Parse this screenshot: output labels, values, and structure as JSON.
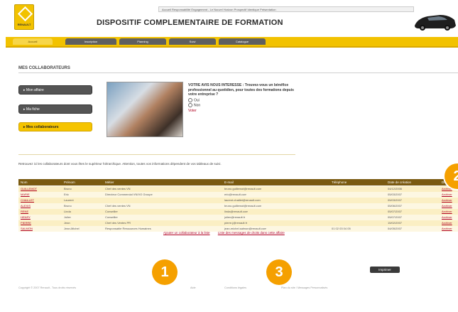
{
  "header": {
    "brand": "RENAULT",
    "topbar_text": "Accueil   Responsabilité Engagement - Le Nouvel Horizon   Prospectif Identique   Présentation",
    "title": "DISPOSITIF COMPLEMENTAIRE DE FORMATION",
    "tabs": [
      {
        "label": "Accueil",
        "active": true
      },
      {
        "label": "Inscription",
        "active": false
      },
      {
        "label": "Planning",
        "active": false
      },
      {
        "label": "Suivi",
        "active": false
      },
      {
        "label": "Catalogue",
        "active": false
      }
    ]
  },
  "section_title": "MES COLLABORATEURS",
  "sidebar": [
    {
      "label": "▸ Mon affaire",
      "style": "gray"
    },
    {
      "label": "▸ Ma fiche",
      "style": "gray"
    },
    {
      "label": "▸ Mes collaborateurs",
      "style": "yellow"
    }
  ],
  "poll": {
    "question": "VOTRE AVIS NOUS INTERESSE : Trouvez-vous un bénéfice professionnel au quotidien, pour toutes des formations depuis votre entreprise ?",
    "options": [
      "Oui",
      "Non"
    ],
    "vote": "Voter"
  },
  "info_text": "Retrouvez ici les collaborateurs dont vous êtes le supérieur hiérarchique. Attention, toutes vos informations dépendent de vos tableaux de suivi.",
  "table": {
    "headers": [
      "Nom",
      "Prénom",
      "Métier",
      "E-mail",
      "Téléphone",
      "Date de création",
      "Droits"
    ],
    "rows": [
      [
        "GUILLEMOT",
        "Bruno",
        "Chef des ventes VN",
        "bruno.guillemot@renault.com",
        "",
        "04/12/2006",
        "Archiver"
      ],
      [
        "MARIE",
        "Eric",
        "Directeur Commercial VN/VO Groupe",
        "eric@renault.com",
        "",
        "05/03/2007",
        "Archiver"
      ],
      [
        "CHAILLET",
        "Laurent",
        "",
        "laurent.chaillet@renault.com",
        "",
        "05/03/2007",
        "Archiver"
      ],
      [
        "ALEXIS",
        "Bruno",
        "Chef des ventes VN",
        "bruno.guillemot@renault.com",
        "",
        "05/06/2007",
        "Archiver"
      ],
      [
        "RENE",
        "Linda",
        "Conseiller",
        "linda@renault.com",
        "",
        "05/07/2007",
        "Archiver"
      ],
      [
        "HENRY",
        "Julien",
        "Conseiller",
        "julien@renault.fr",
        "",
        "05/07/2007",
        "Archiver"
      ],
      [
        "PIERRE",
        "Jean",
        "Chef des Ventes PR",
        "pierre.j@renault.fr",
        "",
        "15/02/2007",
        "Archiver"
      ],
      [
        "SALMON",
        "Jean-Michel",
        "Responsable Ressources Humaines",
        "jean-michel.salmon@renault.com",
        "01 02 03 04 05",
        "04/05/2007",
        "Archiver"
      ]
    ]
  },
  "bottom_links": [
    "Ajouter un collaborateur à la liste",
    "Liste des messages de droits dans cette affaire"
  ],
  "print_button": "Imprimer",
  "footer": {
    "copyright": "Copyright © 2007 Renault - Tous droits réservés",
    "links": [
      "Aide",
      "Conditions légales",
      "Plan du site / Messages Personnalisés"
    ]
  },
  "badges": [
    "1",
    "2",
    "3"
  ],
  "colors": {
    "accent": "#f2c200",
    "header_row": "#7a5a10",
    "link": "#b00020",
    "badge": "#f5a000"
  }
}
